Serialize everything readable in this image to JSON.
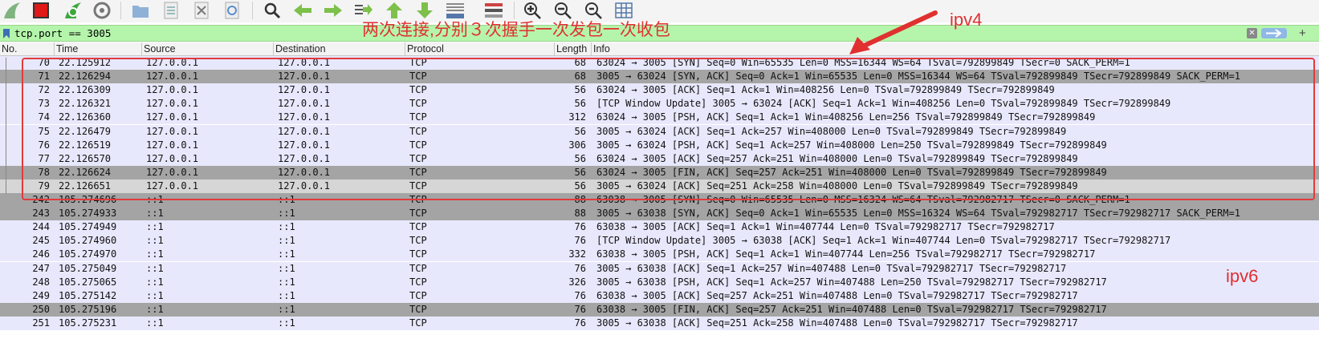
{
  "filter": {
    "value": "tcp.port == 3005"
  },
  "columns": [
    "No.",
    "Time",
    "Source",
    "Destination",
    "Protocol",
    "Length",
    "Info"
  ],
  "annotations": {
    "main": "两次连接,分别３次握手一次发包一次收包",
    "ipv4": "ipv4",
    "ipv6": "ipv6"
  },
  "colors": {
    "row_normal": "#e8e8fd",
    "row_dark": "#a4a4a4",
    "row_selected": "#d6d6d6",
    "row_white": "#ffffff",
    "annotation": "#e03030",
    "filter_valid": "#b5f5ab"
  },
  "icons": [
    "shark-fin-start-icon",
    "stop-capture-icon",
    "restart-capture-icon",
    "capture-options-icon",
    "open-file-icon",
    "save-file-icon",
    "close-file-icon",
    "reload-icon",
    "find-packet-icon",
    "go-back-icon",
    "go-forward-icon",
    "go-to-packet-icon",
    "first-packet-icon",
    "last-packet-icon",
    "autoscroll-icon",
    "colorize-icon",
    "zoom-in-icon",
    "zoom-out-icon",
    "normal-size-icon",
    "resize-columns-icon",
    "bookmark-icon",
    "clear-filter-icon",
    "apply-filter-icon",
    "add-filter-icon"
  ],
  "packets": [
    {
      "no": "70",
      "time": "22.125912",
      "src": "127.0.0.1",
      "dst": "127.0.0.1",
      "proto": "TCP",
      "len": "68",
      "info": "63024 → 3005 [SYN] Seq=0 Win=65535 Len=0 MSS=16344 WS=64 TSval=792899849 TSecr=0 SACK_PERM=1",
      "style": "normal"
    },
    {
      "no": "71",
      "time": "22.126294",
      "src": "127.0.0.1",
      "dst": "127.0.0.1",
      "proto": "TCP",
      "len": "68",
      "info": "3005 → 63024 [SYN, ACK] Seq=0 Ack=1 Win=65535 Len=0 MSS=16344 WS=64 TSval=792899849 TSecr=792899849 SACK_PERM=1",
      "style": "dark"
    },
    {
      "no": "72",
      "time": "22.126309",
      "src": "127.0.0.1",
      "dst": "127.0.0.1",
      "proto": "TCP",
      "len": "56",
      "info": "63024 → 3005 [ACK] Seq=1 Ack=1 Win=408256 Len=0 TSval=792899849 TSecr=792899849",
      "style": "normal"
    },
    {
      "no": "73",
      "time": "22.126321",
      "src": "127.0.0.1",
      "dst": "127.0.0.1",
      "proto": "TCP",
      "len": "56",
      "info": "[TCP Window Update] 3005 → 63024 [ACK] Seq=1 Ack=1 Win=408256 Len=0 TSval=792899849 TSecr=792899849",
      "style": "normal"
    },
    {
      "no": "74",
      "time": "22.126360",
      "src": "127.0.0.1",
      "dst": "127.0.0.1",
      "proto": "TCP",
      "len": "312",
      "info": "63024 → 3005 [PSH, ACK] Seq=1 Ack=1 Win=408256 Len=256 TSval=792899849 TSecr=792899849",
      "style": "normal"
    },
    {
      "no": "75",
      "time": "22.126479",
      "src": "127.0.0.1",
      "dst": "127.0.0.1",
      "proto": "TCP",
      "len": "56",
      "info": "3005 → 63024 [ACK] Seq=1 Ack=257 Win=408000 Len=0 TSval=792899849 TSecr=792899849",
      "style": "normal"
    },
    {
      "no": "76",
      "time": "22.126519",
      "src": "127.0.0.1",
      "dst": "127.0.0.1",
      "proto": "TCP",
      "len": "306",
      "info": "3005 → 63024 [PSH, ACK] Seq=1 Ack=257 Win=408000 Len=250 TSval=792899849 TSecr=792899849",
      "style": "normal"
    },
    {
      "no": "77",
      "time": "22.126570",
      "src": "127.0.0.1",
      "dst": "127.0.0.1",
      "proto": "TCP",
      "len": "56",
      "info": "63024 → 3005 [ACK] Seq=257 Ack=251 Win=408000 Len=0 TSval=792899849 TSecr=792899849",
      "style": "normal"
    },
    {
      "no": "78",
      "time": "22.126624",
      "src": "127.0.0.1",
      "dst": "127.0.0.1",
      "proto": "TCP",
      "len": "56",
      "info": "63024 → 3005 [FIN, ACK] Seq=257 Ack=251 Win=408000 Len=0 TSval=792899849 TSecr=792899849",
      "style": "dark"
    },
    {
      "no": "79",
      "time": "22.126651",
      "src": "127.0.0.1",
      "dst": "127.0.0.1",
      "proto": "TCP",
      "len": "56",
      "info": "3005 → 63024 [ACK] Seq=251 Ack=258 Win=408000 Len=0 TSval=792899849 TSecr=792899849",
      "style": "selected"
    },
    {
      "no": "242",
      "time": "105.274696",
      "src": "::1",
      "dst": "::1",
      "proto": "TCP",
      "len": "88",
      "info": "63038 → 3005 [SYN] Seq=0 Win=65535 Len=0 MSS=16324 WS=64 TSval=792982717 TSecr=0 SACK_PERM=1",
      "style": "dark"
    },
    {
      "no": "243",
      "time": "105.274933",
      "src": "::1",
      "dst": "::1",
      "proto": "TCP",
      "len": "88",
      "info": "3005 → 63038 [SYN, ACK] Seq=0 Ack=1 Win=65535 Len=0 MSS=16324 WS=64 TSval=792982717 TSecr=792982717 SACK_PERM=1",
      "style": "dark"
    },
    {
      "no": "244",
      "time": "105.274949",
      "src": "::1",
      "dst": "::1",
      "proto": "TCP",
      "len": "76",
      "info": "63038 → 3005 [ACK] Seq=1 Ack=1 Win=407744 Len=0 TSval=792982717 TSecr=792982717",
      "style": "normal"
    },
    {
      "no": "245",
      "time": "105.274960",
      "src": "::1",
      "dst": "::1",
      "proto": "TCP",
      "len": "76",
      "info": "[TCP Window Update] 3005 → 63038 [ACK] Seq=1 Ack=1 Win=407744 Len=0 TSval=792982717 TSecr=792982717",
      "style": "normal"
    },
    {
      "no": "246",
      "time": "105.274970",
      "src": "::1",
      "dst": "::1",
      "proto": "TCP",
      "len": "332",
      "info": "63038 → 3005 [PSH, ACK] Seq=1 Ack=1 Win=407744 Len=256 TSval=792982717 TSecr=792982717",
      "style": "normal"
    },
    {
      "no": "247",
      "time": "105.275049",
      "src": "::1",
      "dst": "::1",
      "proto": "TCP",
      "len": "76",
      "info": "3005 → 63038 [ACK] Seq=1 Ack=257 Win=407488 Len=0 TSval=792982717 TSecr=792982717",
      "style": "normal"
    },
    {
      "no": "248",
      "time": "105.275065",
      "src": "::1",
      "dst": "::1",
      "proto": "TCP",
      "len": "326",
      "info": "3005 → 63038 [PSH, ACK] Seq=1 Ack=257 Win=407488 Len=250 TSval=792982717 TSecr=792982717",
      "style": "normal"
    },
    {
      "no": "249",
      "time": "105.275142",
      "src": "::1",
      "dst": "::1",
      "proto": "TCP",
      "len": "76",
      "info": "63038 → 3005 [ACK] Seq=257 Ack=251 Win=407488 Len=0 TSval=792982717 TSecr=792982717",
      "style": "normal"
    },
    {
      "no": "250",
      "time": "105.275196",
      "src": "::1",
      "dst": "::1",
      "proto": "TCP",
      "len": "76",
      "info": "63038 → 3005 [FIN, ACK] Seq=257 Ack=251 Win=407488 Len=0 TSval=792982717 TSecr=792982717",
      "style": "dark"
    },
    {
      "no": "251",
      "time": "105.275231",
      "src": "::1",
      "dst": "::1",
      "proto": "TCP",
      "len": "76",
      "info": "3005 → 63038 [ACK] Seq=251 Ack=258 Win=407488 Len=0 TSval=792982717 TSecr=792982717",
      "style": "normal"
    }
  ]
}
